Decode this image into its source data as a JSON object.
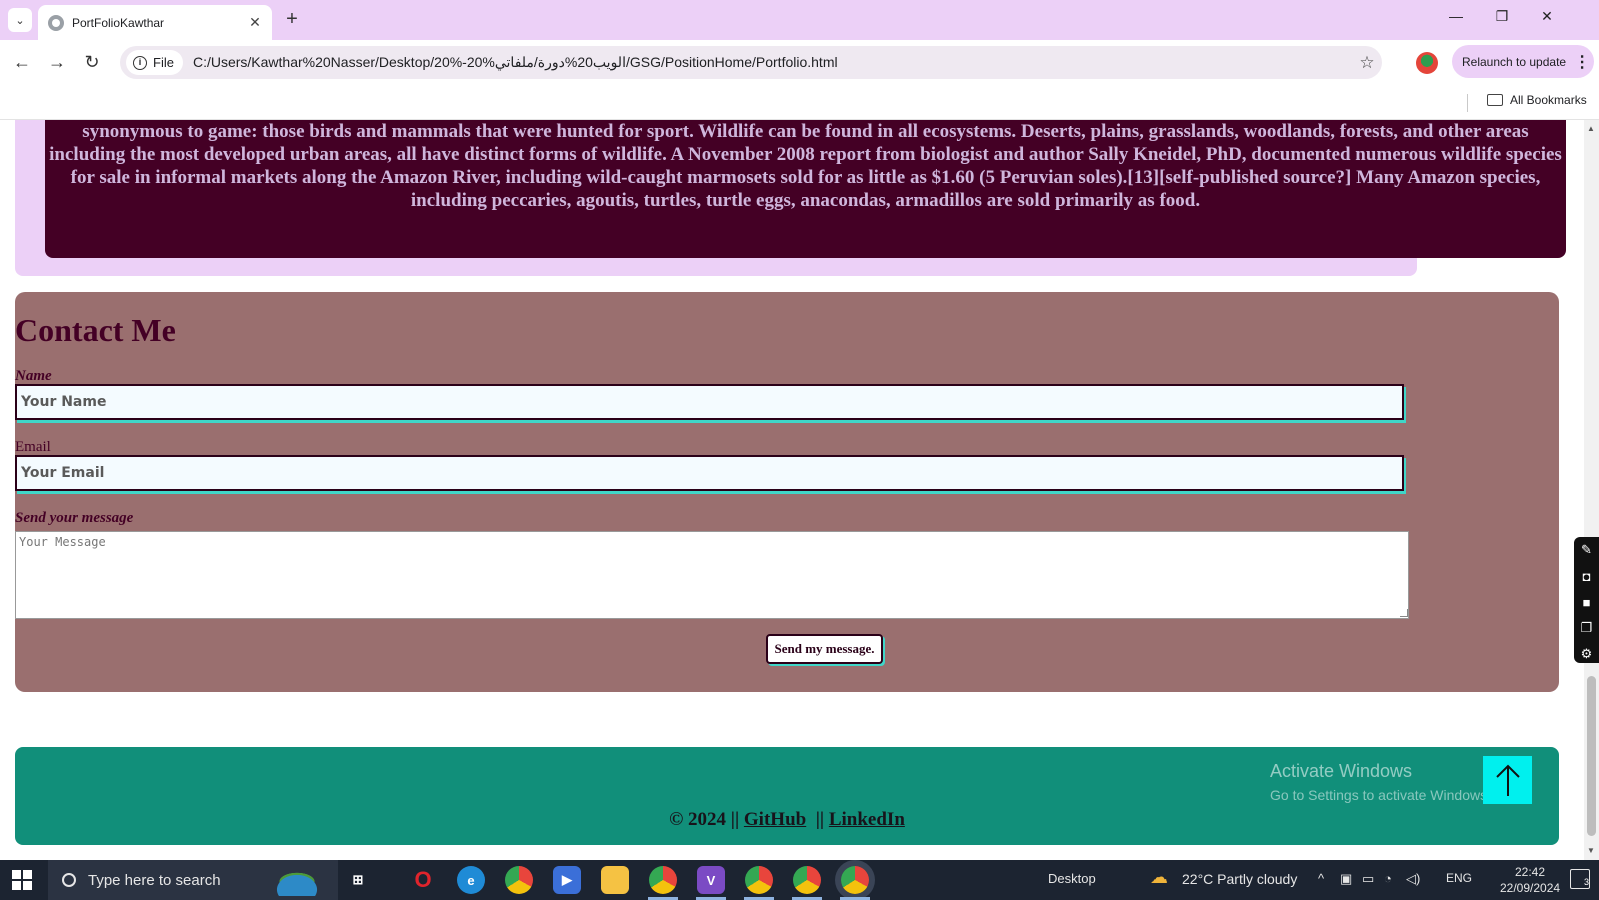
{
  "browser": {
    "tab_title": "PortFolioKawthar",
    "file_chip": "File",
    "url": "C:/Users/Kawthar%20Nasser/Desktop/20%-20%الويب20%دورة/ملفاتي/GSG/PositionHome/Portfolio.html",
    "relaunch_label": "Relaunch to update",
    "bookmarks_label": "All Bookmarks"
  },
  "about": {
    "text": "synonymous to game: those birds and mammals that were hunted for sport. Wildlife can be found in all ecosystems. Deserts, plains, grasslands, woodlands, forests, and other areas including the most developed urban areas, all have distinct forms of wildlife. A November 2008 report from biologist and author Sally Kneidel, PhD, documented numerous wildlife species for sale in informal markets along the Amazon River, including wild-caught marmosets sold for as little as $1.60 (5 Peruvian soles).[13][self-published source?] Many Amazon species, including peccaries, agoutis, turtles, turtle eggs, anacondas, armadillos are sold primarily as food."
  },
  "contact": {
    "title": "Contact Me",
    "name_label": "Name",
    "name_placeholder": "Your Name",
    "email_label": "Email",
    "email_placeholder": "Your Email",
    "message_label": "Send your message",
    "message_placeholder": "Your Message",
    "send_label": "Send my message."
  },
  "footer": {
    "copyright": "© 2024 ||",
    "github": "GitHub",
    "separator": "||",
    "linkedin": "LinkedIn"
  },
  "watermark": {
    "title": "Activate Windows",
    "subtitle": "Go to Settings to activate Windows."
  },
  "taskbar": {
    "search_placeholder": "Type here to search",
    "desktop_label": "Desktop",
    "weather": "22°C  Partly cloudy",
    "language": "ENG",
    "time": "22:42",
    "date": "22/09/2024",
    "notifications": "3"
  },
  "colors": {
    "about_bg": "#440025",
    "contact_bg": "#9a6f6f",
    "footer_bg": "#118f7a",
    "accent": "#3fd6c8",
    "chrome_tint": "#ecd0f7"
  }
}
